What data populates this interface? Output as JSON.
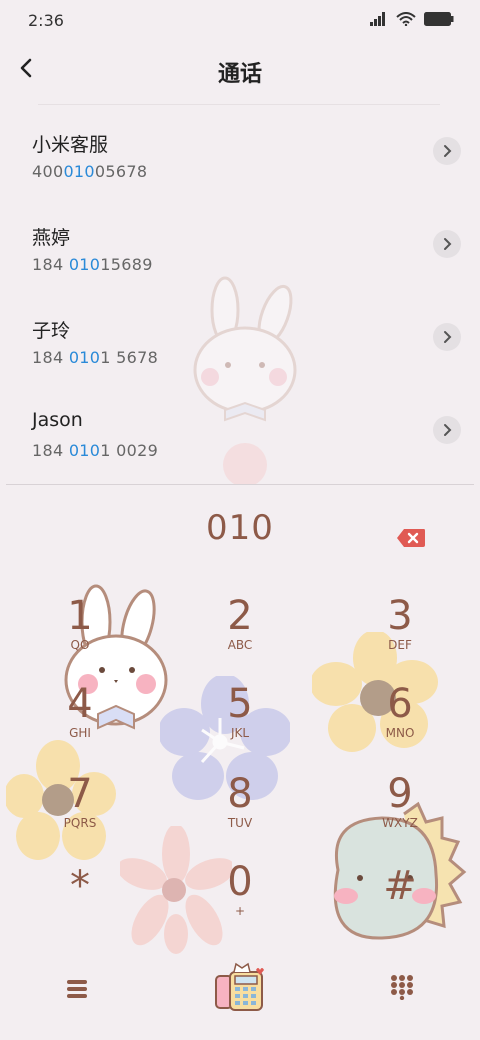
{
  "status": {
    "time": "2:36"
  },
  "header": {
    "title": "通话"
  },
  "contacts": [
    {
      "name": "小米客服",
      "number_pre": "400",
      "number_hl": "010",
      "number_post": "05678"
    },
    {
      "name": "燕婷",
      "number_pre": "184 ",
      "number_hl": "010",
      "number_post": "15689"
    },
    {
      "name": "子玲",
      "number_pre": "184 ",
      "number_hl": "010",
      "number_post": "1 5678"
    },
    {
      "name": "Jason",
      "number_pre": "184 ",
      "number_hl": "010",
      "number_post": "1 0029"
    }
  ],
  "dialer": {
    "input": "010",
    "keys": [
      {
        "digit": "1",
        "letters": "QO"
      },
      {
        "digit": "2",
        "letters": "ABC"
      },
      {
        "digit": "3",
        "letters": "DEF"
      },
      {
        "digit": "4",
        "letters": "GHI"
      },
      {
        "digit": "5",
        "letters": "JKL"
      },
      {
        "digit": "6",
        "letters": "MNO"
      },
      {
        "digit": "7",
        "letters": "PQRS"
      },
      {
        "digit": "8",
        "letters": "TUV"
      },
      {
        "digit": "9",
        "letters": "WXYZ"
      },
      {
        "digit": "*",
        "letters": ""
      },
      {
        "digit": "0",
        "letters": "+"
      },
      {
        "digit": "#",
        "letters": ""
      }
    ]
  },
  "icons": {
    "back": "chevron-left-icon",
    "arrow": "chevron-right-icon",
    "backspace": "backspace-icon",
    "menu": "menu-icon",
    "call": "call-icon",
    "keypad": "keypad-icon"
  },
  "colors": {
    "accent": "#8d5a48",
    "highlight": "#2a8ad8",
    "background": "#f3eef1"
  }
}
